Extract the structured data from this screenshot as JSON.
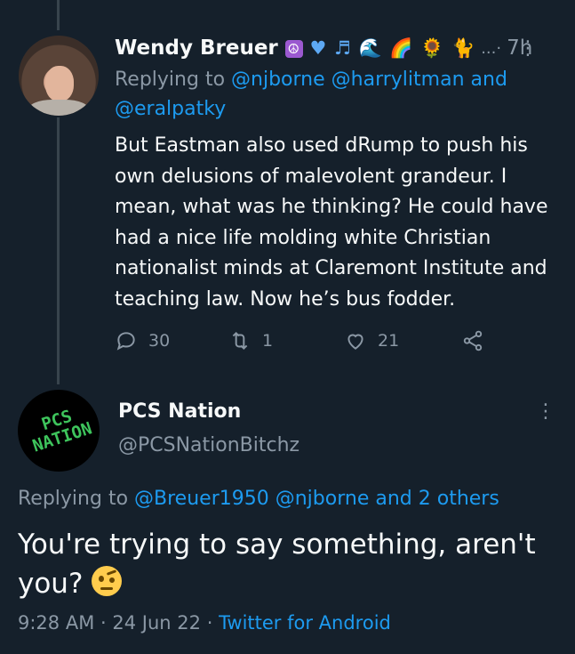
{
  "tweet1": {
    "name": "Wendy Breuer",
    "emojis": {
      "peace": "☮",
      "heart": "♥",
      "notes": "♬",
      "wave": "🌊",
      "rainbow": "🌈",
      "flower": "🌻",
      "cat": "🐈"
    },
    "ellipsis": "...·",
    "time": "7h",
    "replying_prefix": "Replying to",
    "mentions": [
      "@njborne",
      "@harrylitman",
      "and",
      "@eralpatky"
    ],
    "body": "But Eastman also used dRump to push his own delusions of malevolent grandeur. I mean, what was he thinking? He could have had a nice life molding white Christian nationalist minds at Claremont Institute and teaching law. Now he’s bus fodder.",
    "reply_count": "30",
    "retweet_count": "1",
    "like_count": "21"
  },
  "tweet2": {
    "name": "PCS Nation",
    "handle": "@PCSNationBitchz",
    "avatar_text": "PCS NATION",
    "replying_prefix": "Replying to",
    "mentions": [
      "@Breuer1950",
      "@njborne",
      "and 2 others"
    ],
    "body": "You're trying to say something, aren't you?",
    "time": "9:28 AM",
    "separator": "·",
    "date": "24 Jun 22",
    "source": "Twitter for Android"
  },
  "colors": {
    "background": "#15202b",
    "text": "#f7f9f9",
    "secondary": "#8b98a5",
    "link": "#1d9bf0",
    "thread_line": "#38444d"
  },
  "icons": [
    "reply-icon",
    "retweet-icon",
    "like-icon",
    "share-icon",
    "more-icon"
  ]
}
